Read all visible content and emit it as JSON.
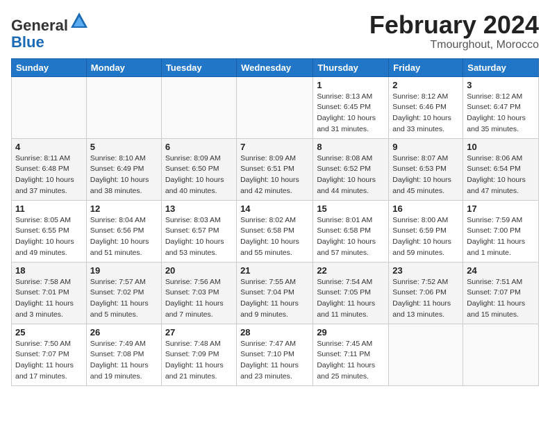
{
  "header": {
    "logo_line1": "General",
    "logo_line2": "Blue",
    "month_title": "February 2024",
    "location": "Tmourghout, Morocco"
  },
  "weekdays": [
    "Sunday",
    "Monday",
    "Tuesday",
    "Wednesday",
    "Thursday",
    "Friday",
    "Saturday"
  ],
  "weeks": [
    [
      {
        "day": "",
        "info": ""
      },
      {
        "day": "",
        "info": ""
      },
      {
        "day": "",
        "info": ""
      },
      {
        "day": "",
        "info": ""
      },
      {
        "day": "1",
        "info": "Sunrise: 8:13 AM\nSunset: 6:45 PM\nDaylight: 10 hours\nand 31 minutes."
      },
      {
        "day": "2",
        "info": "Sunrise: 8:12 AM\nSunset: 6:46 PM\nDaylight: 10 hours\nand 33 minutes."
      },
      {
        "day": "3",
        "info": "Sunrise: 8:12 AM\nSunset: 6:47 PM\nDaylight: 10 hours\nand 35 minutes."
      }
    ],
    [
      {
        "day": "4",
        "info": "Sunrise: 8:11 AM\nSunset: 6:48 PM\nDaylight: 10 hours\nand 37 minutes."
      },
      {
        "day": "5",
        "info": "Sunrise: 8:10 AM\nSunset: 6:49 PM\nDaylight: 10 hours\nand 38 minutes."
      },
      {
        "day": "6",
        "info": "Sunrise: 8:09 AM\nSunset: 6:50 PM\nDaylight: 10 hours\nand 40 minutes."
      },
      {
        "day": "7",
        "info": "Sunrise: 8:09 AM\nSunset: 6:51 PM\nDaylight: 10 hours\nand 42 minutes."
      },
      {
        "day": "8",
        "info": "Sunrise: 8:08 AM\nSunset: 6:52 PM\nDaylight: 10 hours\nand 44 minutes."
      },
      {
        "day": "9",
        "info": "Sunrise: 8:07 AM\nSunset: 6:53 PM\nDaylight: 10 hours\nand 45 minutes."
      },
      {
        "day": "10",
        "info": "Sunrise: 8:06 AM\nSunset: 6:54 PM\nDaylight: 10 hours\nand 47 minutes."
      }
    ],
    [
      {
        "day": "11",
        "info": "Sunrise: 8:05 AM\nSunset: 6:55 PM\nDaylight: 10 hours\nand 49 minutes."
      },
      {
        "day": "12",
        "info": "Sunrise: 8:04 AM\nSunset: 6:56 PM\nDaylight: 10 hours\nand 51 minutes."
      },
      {
        "day": "13",
        "info": "Sunrise: 8:03 AM\nSunset: 6:57 PM\nDaylight: 10 hours\nand 53 minutes."
      },
      {
        "day": "14",
        "info": "Sunrise: 8:02 AM\nSunset: 6:58 PM\nDaylight: 10 hours\nand 55 minutes."
      },
      {
        "day": "15",
        "info": "Sunrise: 8:01 AM\nSunset: 6:58 PM\nDaylight: 10 hours\nand 57 minutes."
      },
      {
        "day": "16",
        "info": "Sunrise: 8:00 AM\nSunset: 6:59 PM\nDaylight: 10 hours\nand 59 minutes."
      },
      {
        "day": "17",
        "info": "Sunrise: 7:59 AM\nSunset: 7:00 PM\nDaylight: 11 hours\nand 1 minute."
      }
    ],
    [
      {
        "day": "18",
        "info": "Sunrise: 7:58 AM\nSunset: 7:01 PM\nDaylight: 11 hours\nand 3 minutes."
      },
      {
        "day": "19",
        "info": "Sunrise: 7:57 AM\nSunset: 7:02 PM\nDaylight: 11 hours\nand 5 minutes."
      },
      {
        "day": "20",
        "info": "Sunrise: 7:56 AM\nSunset: 7:03 PM\nDaylight: 11 hours\nand 7 minutes."
      },
      {
        "day": "21",
        "info": "Sunrise: 7:55 AM\nSunset: 7:04 PM\nDaylight: 11 hours\nand 9 minutes."
      },
      {
        "day": "22",
        "info": "Sunrise: 7:54 AM\nSunset: 7:05 PM\nDaylight: 11 hours\nand 11 minutes."
      },
      {
        "day": "23",
        "info": "Sunrise: 7:52 AM\nSunset: 7:06 PM\nDaylight: 11 hours\nand 13 minutes."
      },
      {
        "day": "24",
        "info": "Sunrise: 7:51 AM\nSunset: 7:07 PM\nDaylight: 11 hours\nand 15 minutes."
      }
    ],
    [
      {
        "day": "25",
        "info": "Sunrise: 7:50 AM\nSunset: 7:07 PM\nDaylight: 11 hours\nand 17 minutes."
      },
      {
        "day": "26",
        "info": "Sunrise: 7:49 AM\nSunset: 7:08 PM\nDaylight: 11 hours\nand 19 minutes."
      },
      {
        "day": "27",
        "info": "Sunrise: 7:48 AM\nSunset: 7:09 PM\nDaylight: 11 hours\nand 21 minutes."
      },
      {
        "day": "28",
        "info": "Sunrise: 7:47 AM\nSunset: 7:10 PM\nDaylight: 11 hours\nand 23 minutes."
      },
      {
        "day": "29",
        "info": "Sunrise: 7:45 AM\nSunset: 7:11 PM\nDaylight: 11 hours\nand 25 minutes."
      },
      {
        "day": "",
        "info": ""
      },
      {
        "day": "",
        "info": ""
      }
    ]
  ]
}
